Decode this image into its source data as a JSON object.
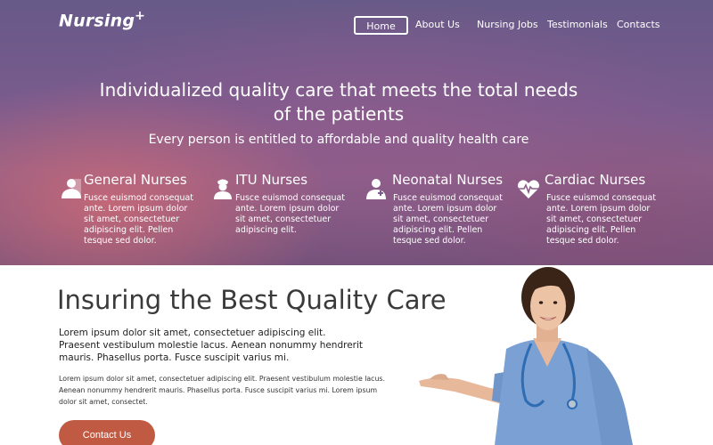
{
  "header": {
    "logo": "Nursing",
    "logo_plus": "+",
    "nav": [
      {
        "label": "Home",
        "active": true
      },
      {
        "label": "About Us",
        "active": false
      },
      {
        "label": "Nursing Jobs",
        "active": false
      },
      {
        "label": "Testimonials",
        "active": false
      },
      {
        "label": "Contacts",
        "active": false
      }
    ]
  },
  "hero": {
    "title_line1": "Individualized quality care that meets the total needs",
    "title_line2": "of the patients",
    "subtitle": "Every person is entitled to affordable and quality health care",
    "features": [
      {
        "title": "General Nurses",
        "icon": "person-half-icon",
        "text": "Fusce euismod consequat ante. Lorem ipsum dolor sit amet, consectetuer adipiscing elit. Pellen tesque sed dolor."
      },
      {
        "title": "ITU Nurses",
        "icon": "nurse-icon",
        "text": "Fusce euismod consequat ante. Lorem ipsum dolor sit amet, consectetuer adipiscing elit."
      },
      {
        "title": "Neonatal Nurses",
        "icon": "doctor-cross-icon",
        "text": "Fusce euismod consequat ante. Lorem ipsum dolor sit amet, consectetuer adipiscing elit. Pellen tesque sed dolor."
      },
      {
        "title": "Cardiac Nurses",
        "icon": "heartbeat-icon",
        "text": "Fusce euismod consequat ante. Lorem ipsum dolor sit amet, consectetuer adipiscing elit. Pellen tesque sed dolor."
      }
    ]
  },
  "main": {
    "title": "Insuring the Best Quality Care",
    "lead_line1": "Lorem ipsum dolor sit amet, consectetuer adipiscing elit.",
    "lead_line2": "Praesent vestibulum molestie lacus. Aenean nonummy hendrerit",
    "lead_line3": "mauris. Phasellus porta. Fusce suscipit varius mi.",
    "body_line1": "Lorem ipsum dolor sit amet, consectetuer adipiscing elit. Praesent vestibulum molestie lacus.",
    "body_line2": "Aenean nonummy hendrerit mauris. Phasellus porta. Fusce suscipit varius mi. Lorem ipsum",
    "body_line3": "dolor sit amet, consectet.",
    "cta": "Contact Us"
  },
  "colors": {
    "accent": "#c05a43",
    "scrub": "#6f95c9",
    "hero_purple": "#7a5b8e"
  }
}
